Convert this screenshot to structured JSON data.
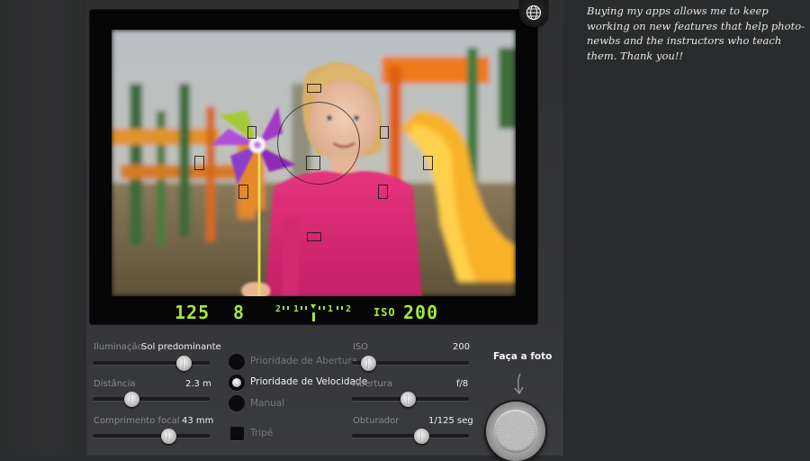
{
  "support_message": "Buying my apps allows me to keep working on new features that help photo-newbs and the instructors who teach them. Thank you!!",
  "viewfinder": {
    "shutter": "125",
    "aperture": "8",
    "meter_left": "2",
    "meter_mid_left": "1",
    "meter_mid_right": "1",
    "meter_right": "2",
    "iso_label": "ISO",
    "iso": "200"
  },
  "controls": {
    "lighting": {
      "label": "Iluminação",
      "value": "Sol predominante",
      "level": 0.78
    },
    "distance": {
      "label": "Distância",
      "value": "2.3 m",
      "level": 0.35
    },
    "focal_length": {
      "label": "Comprimento focal",
      "value": "43 mm",
      "level": 0.65
    },
    "iso": {
      "label": "ISO",
      "value": "200",
      "level": 0.15
    },
    "aperture": {
      "label": "Abertura",
      "value": "f/8",
      "level": 0.48
    },
    "shutter_speed": {
      "label": "Obturador",
      "value": "1/125 seg",
      "level": 0.6
    }
  },
  "modes": {
    "aperture_priority": "Prioridade de Abertura",
    "speed_priority": "Prioridade de Velocidade",
    "manual": "Manual",
    "selected": "speed_priority"
  },
  "tripod_label": "Tripé",
  "take_photo_label": "Faça a foto",
  "icons": {
    "globe": "globe-icon",
    "arrow": "arrow-down-icon",
    "shutter": "shutter-button-icon"
  },
  "colors": {
    "readout": "#a6e83a",
    "background": "#2a2b2c"
  }
}
